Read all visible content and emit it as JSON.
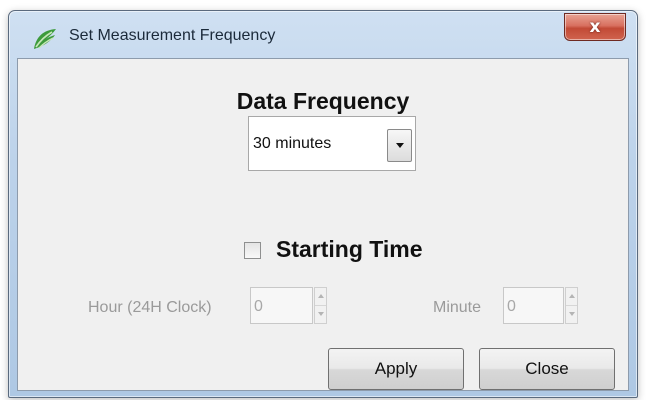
{
  "window": {
    "title": "Set Measurement Frequency",
    "close_glyph": "x",
    "app_icon": "green-leaf-icon"
  },
  "data_frequency": {
    "heading": "Data Frequency",
    "selected": "30 minutes"
  },
  "starting_time": {
    "label": "Starting Time",
    "checked": false,
    "hour_label": "Hour (24H Clock)",
    "hour_value": "0",
    "minute_label": "Minute",
    "minute_value": "0",
    "enabled": false
  },
  "buttons": {
    "apply": "Apply",
    "close": "Close"
  },
  "colors": {
    "title_bar": "#bcd2ea",
    "close_button": "#c24a36",
    "client_background": "#f0f0f0",
    "disabled_text": "#9a9a9a"
  }
}
